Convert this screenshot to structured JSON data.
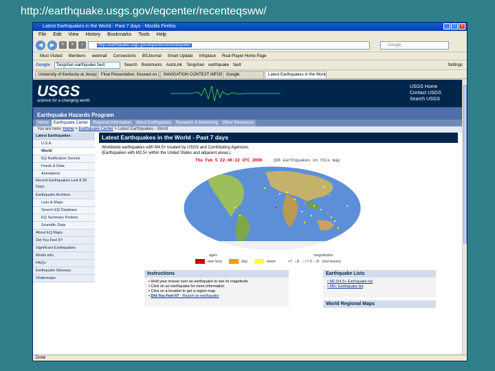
{
  "slide": {
    "caption": "http://earthquake.usgs.gov/eqcenter/recenteqsww/"
  },
  "browser": {
    "title": "Latest Earthquakes in the World - Past 7 days - Mozilla Firefox",
    "menu": [
      "File",
      "Edit",
      "View",
      "History",
      "Bookmarks",
      "Tools",
      "Help"
    ],
    "url": "http://earthquake.usgs.gov/eqcenter/recenteqsww/",
    "search_placeholder": "Google",
    "bookmarks": [
      "Most Visited",
      "Members",
      "webmail",
      "Connections",
      "BSJournal",
      "Smart Update",
      "Infoplace",
      "Real Player Home Page"
    ],
    "toolbar_search": "Tangshan earthquake fault",
    "toolbar_items": [
      "Search",
      "Bookmarks",
      "AutoLink",
      "Tangshan",
      "earthquake",
      "fault",
      "Settings"
    ],
    "tabs": [
      "University of Kentucky at Jesop Science",
      "Final Presentation: focused on 2010...",
      "NAVIGATION CONTEXT INFORMATION",
      "Google",
      "Latest Earthquakes in the World - ..."
    ],
    "status": "Done"
  },
  "site": {
    "logo": "USGS",
    "tagline": "science for a changing world",
    "links": [
      "USGS Home",
      "Contact USGS",
      "Search USGS"
    ],
    "program": "Earthquake Hazards Program",
    "subnav": [
      "Home",
      "Earthquake Center",
      "Regional Information",
      "About Earthquakes",
      "Research & Monitoring",
      "Other Resources"
    ],
    "crumb_prefix": "You are here:",
    "crumbs": [
      "Home",
      "Earthquake Center",
      "Latest Earthquakes - World"
    ]
  },
  "leftnav": [
    {
      "label": "Latest Earthquakes",
      "kind": "hdr"
    },
    {
      "label": "U.S.A.",
      "kind": "sub"
    },
    {
      "label": "World",
      "kind": "cur"
    },
    {
      "label": "EQ Notification Service",
      "kind": "sub"
    },
    {
      "label": "Feeds & Data",
      "kind": "sub"
    },
    {
      "label": "Animations",
      "kind": "sub"
    },
    {
      "label": "Recent Earthquakes Last 8-30 Days",
      "kind": "tall"
    },
    {
      "label": "Earthquake Archives",
      "kind": ""
    },
    {
      "label": "Lists & Maps",
      "kind": "sub"
    },
    {
      "label": "Search EQ Database",
      "kind": "sub"
    },
    {
      "label": "EQ Summary Posters",
      "kind": "sub"
    },
    {
      "label": "Scientific Data",
      "kind": "sub"
    },
    {
      "label": "About EQ Maps",
      "kind": ""
    },
    {
      "label": "Did You Feel It?",
      "kind": ""
    },
    {
      "label": "Significant Earthquakes",
      "kind": ""
    },
    {
      "label": "Media Info",
      "kind": ""
    },
    {
      "label": "FAQ's",
      "kind": ""
    },
    {
      "label": "Earthquake Glossary",
      "kind": ""
    },
    {
      "label": "Shakemaps",
      "kind": ""
    }
  ],
  "main": {
    "title": "Latest Earthquakes in the World - Past 7 days",
    "desc1": "Worldwide earthquakes with M4.5+ located by USGS and Contributing Agencies.",
    "desc2": "(Earthquakes with M2.5+ within the United States and adjacent areas.)",
    "map_time": "Thu Feb  5 22:46:22 UTC 2009",
    "map_count": "168 earthquakes on this map",
    "legend_ages": "ages",
    "legend_mags": "magnitudes",
    "ages": [
      {
        "label": "last hour",
        "color": "#cc0000"
      },
      {
        "label": "day",
        "color": "#ff9900"
      },
      {
        "label": "week",
        "color": "#ffff33"
      }
    ],
    "mags": [
      "<7",
      "□6",
      "○○7.5",
      "□9",
      "(red boxes)"
    ]
  },
  "instructions": {
    "title": "Instructions",
    "items": [
      "Hold your mouse over an earthquake to see its magnitude",
      "Click on an earthquake for more information",
      "Click on a location to get a region map"
    ],
    "link_bold": "Did You Feel It?",
    "link_rest": " - Report an earthquake"
  },
  "eqlists": {
    "title": "Earthquake Lists",
    "items": [
      "M2.5/4.5+ Earthquake list",
      "M5+ Earthquake list"
    ]
  },
  "worldmaps": {
    "title": "World Regional Maps"
  }
}
